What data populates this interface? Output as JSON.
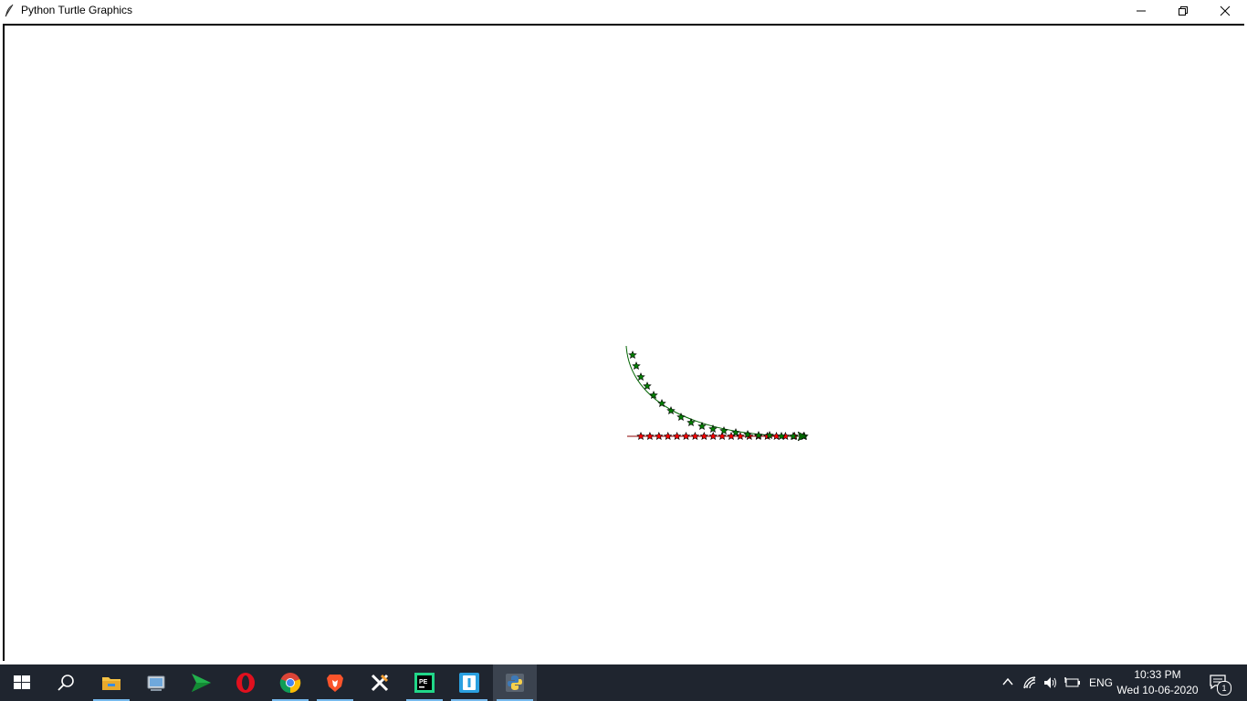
{
  "window": {
    "title": "Python Turtle Graphics",
    "controls": {
      "minimize": "minimize",
      "restore": "restore",
      "close": "close"
    }
  },
  "canvas": {
    "background": "#ffffff",
    "curve_color": "#006400",
    "line_color": "#8b0000",
    "star_green": "#008000",
    "star_red": "#ff0000"
  },
  "taskbar": {
    "pinned": [
      {
        "name": "start-button",
        "icon": "windows-logo-icon"
      },
      {
        "name": "search-button",
        "icon": "search-icon"
      },
      {
        "name": "file-explorer",
        "icon": "folder-icon",
        "active": true
      },
      {
        "name": "control-panel",
        "icon": "control-panel-icon"
      },
      {
        "name": "send-app",
        "icon": "paper-plane-icon"
      },
      {
        "name": "opera",
        "icon": "opera-icon"
      },
      {
        "name": "chrome",
        "icon": "chrome-icon",
        "active": true
      },
      {
        "name": "brave",
        "icon": "brave-icon",
        "active": true
      },
      {
        "name": "xampp",
        "icon": "xampp-icon"
      },
      {
        "name": "pycharm",
        "icon": "pycharm-icon",
        "active": true
      },
      {
        "name": "code-editor",
        "icon": "editor-icon",
        "active": true
      },
      {
        "name": "python",
        "icon": "python-icon",
        "active": true,
        "selected": true
      }
    ],
    "tray": {
      "language": "ENG",
      "time": "10:33 PM",
      "date": "Wed 10-06-2020",
      "notifications": "1"
    }
  }
}
